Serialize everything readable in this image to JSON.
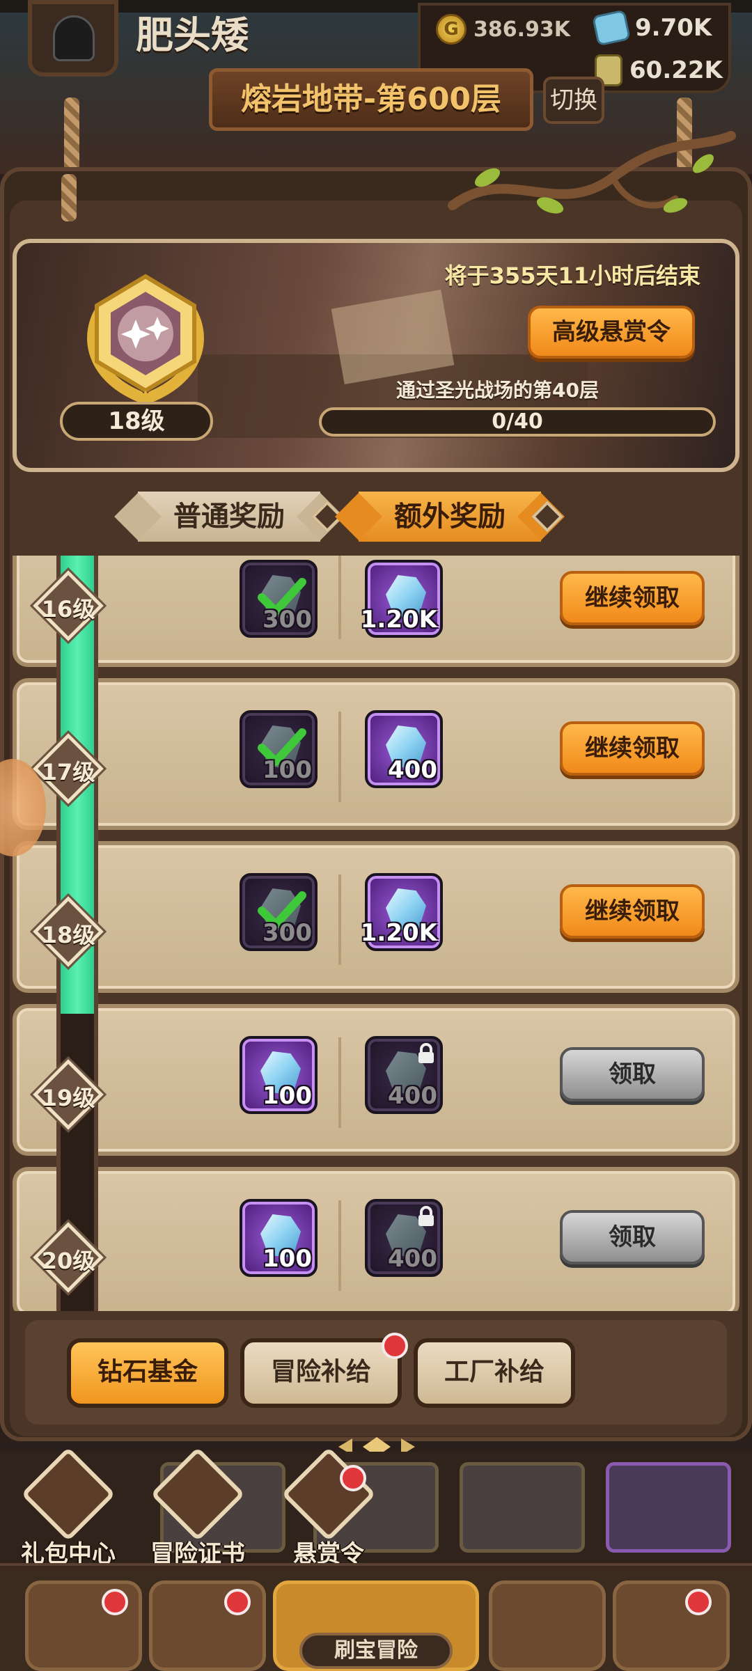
{
  "hud": {
    "player_name": "肥头矮",
    "resources": [
      {
        "icon": "gold-coin-icon",
        "value": "386.93K"
      },
      {
        "icon": "gem-icon",
        "value": "9.70K"
      },
      {
        "icon": "energy-can-icon",
        "value": "60.22K"
      }
    ],
    "stage": "熔岩地带-第600层",
    "switch_label": "切换"
  },
  "bounty": {
    "end_time": "将于355天11小时后结束",
    "premium_button": "高级悬赏令",
    "current_level": "18级",
    "task": "通过圣光战场的第40层",
    "task_progress": "0/40",
    "task_progress_fraction": 0
  },
  "tabs": {
    "normal": "普通奖励",
    "extra": "额外奖励"
  },
  "rewards": [
    {
      "level": "16级",
      "normal": {
        "qty": "300",
        "claimed": true
      },
      "extra": {
        "qty": "1.20K",
        "locked": false
      },
      "button": "继续领取",
      "button_style": "orange"
    },
    {
      "level": "17级",
      "normal": {
        "qty": "100",
        "claimed": true
      },
      "extra": {
        "qty": "400",
        "locked": false
      },
      "button": "继续领取",
      "button_style": "orange"
    },
    {
      "level": "18级",
      "normal": {
        "qty": "300",
        "claimed": true
      },
      "extra": {
        "qty": "1.20K",
        "locked": false
      },
      "button": "继续领取",
      "button_style": "orange"
    },
    {
      "level": "19级",
      "normal": {
        "qty": "100",
        "claimed": false
      },
      "extra": {
        "qty": "400",
        "locked": true
      },
      "button": "领取",
      "button_style": "grey"
    },
    {
      "level": "20级",
      "normal": {
        "qty": "100",
        "claimed": false
      },
      "extra": {
        "qty": "400",
        "locked": true
      },
      "button": "领取",
      "button_style": "grey"
    }
  ],
  "sub_tabs": [
    {
      "label": "钻石基金",
      "active": true,
      "badge": false
    },
    {
      "label": "冒险补给",
      "active": false,
      "badge": true
    },
    {
      "label": "工厂补给",
      "active": false,
      "badge": false
    }
  ],
  "shortcuts": [
    {
      "label": "礼包中心",
      "icon": "gift-diamond-icon"
    },
    {
      "label": "冒险证书",
      "icon": "book-icon"
    },
    {
      "label": "悬赏令",
      "icon": "bounty-icon"
    }
  ],
  "nav": {
    "center_label": "刷宝冒险"
  },
  "colors": {
    "accent_orange": "#f08a1a",
    "progress_green": "#2fcf8e",
    "badge_red": "#e0383a"
  }
}
